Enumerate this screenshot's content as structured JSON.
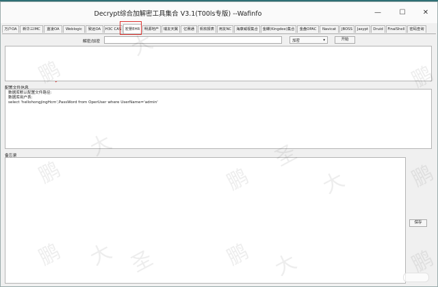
{
  "window": {
    "title": "Decrypt综合加解密工具集合 V3.1(T00ls专版) --Wafinfo",
    "minimize_glyph": "—",
    "maximize_glyph": "☐",
    "close_glyph": "✕"
  },
  "tabs": [
    {
      "label": "万户OA"
    },
    {
      "label": "新华三IMC"
    },
    {
      "label": "蓝凌OA"
    },
    {
      "label": "Weblogic"
    },
    {
      "label": "致远OA"
    },
    {
      "label": "H3C CAS"
    },
    {
      "label": "宏景EHR"
    },
    {
      "label": "明源地产"
    },
    {
      "label": "瑞友天翼"
    },
    {
      "label": "亿赛通"
    },
    {
      "label": "帆软报表"
    },
    {
      "label": "用友NC"
    },
    {
      "label": "海康威视集合"
    },
    {
      "label": "金蝶(Kingdee)集合"
    },
    {
      "label": "金盘OPAC"
    },
    {
      "label": "Navicat"
    },
    {
      "label": "JBOSS"
    },
    {
      "label": "Jasypt"
    },
    {
      "label": "Druid"
    },
    {
      "label": "FinalShell"
    },
    {
      "label": "密码查询"
    }
  ],
  "active_tab": "宏景EHR",
  "crypto": {
    "field_label": "解密/加密",
    "input_value": "",
    "mode_selected": "加密",
    "start_label": "开始"
  },
  "output": {
    "value": ""
  },
  "config": {
    "heading": "配置文件信息",
    "lines": [
      "数据库默认配置文件路径:",
      "数据库用户表:",
      "select 'hellohongjingHcm',PassWord from OperUser where UserName='admin'"
    ]
  },
  "memo": {
    "heading": "备忘录",
    "value": "",
    "save_label": "保存"
  },
  "watermark": {
    "chars": [
      "鹏",
      "大",
      "圣"
    ]
  }
}
